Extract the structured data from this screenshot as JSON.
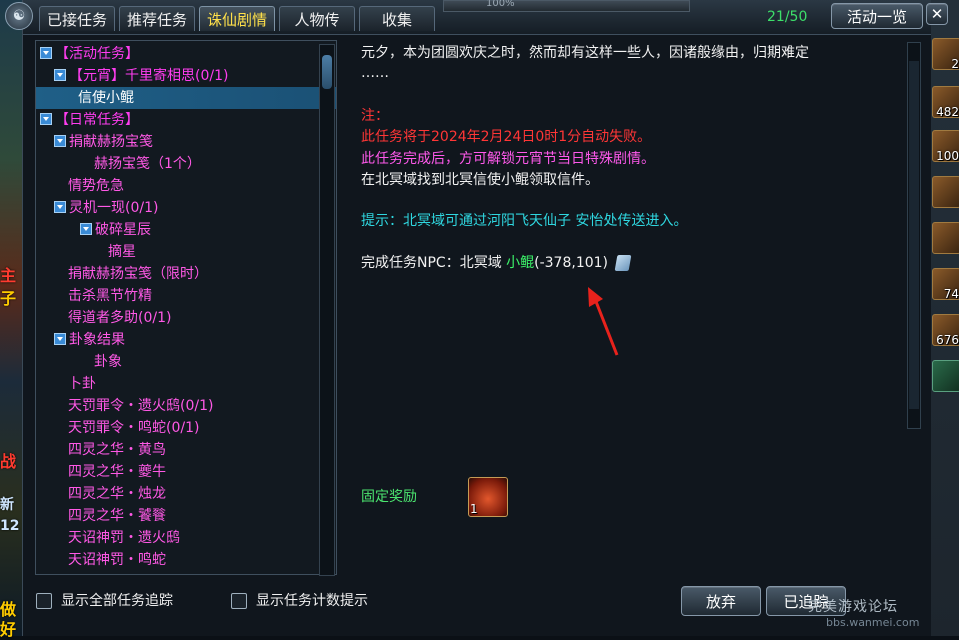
{
  "window": {
    "tabs": [
      {
        "label": "已接任务",
        "active": false
      },
      {
        "label": "推荐任务",
        "active": false
      },
      {
        "label": "诛仙剧情",
        "active": true
      },
      {
        "label": "人物传",
        "active": false
      },
      {
        "label": "收集",
        "active": false
      }
    ],
    "progress_text": "100%",
    "quest_count": "21/50",
    "activity_button": "活动一览",
    "close_icon": "close-icon"
  },
  "tree": {
    "items": [
      {
        "label": "【活动任务】",
        "level": 0,
        "toggle": true,
        "color": "cat"
      },
      {
        "label": "【元宵】千里寄相思(0/1)",
        "level": 1,
        "toggle": true,
        "color": "cat"
      },
      {
        "label": "信使小鲲",
        "level": 2,
        "toggle": false,
        "color": "sel",
        "selected": true
      },
      {
        "label": "【日常任务】",
        "level": 0,
        "toggle": true,
        "color": "cat"
      },
      {
        "label": "捐献赫扬宝笺",
        "level": 1,
        "toggle": true,
        "color": "pink"
      },
      {
        "label": "赫扬宝笺（1个）",
        "level": 2,
        "toggle": false,
        "color": "pink"
      },
      {
        "label": "情势危急",
        "level": 1,
        "toggle": false,
        "color": "pink"
      },
      {
        "label": "灵机一现(0/1)",
        "level": 1,
        "toggle": true,
        "color": "pink"
      },
      {
        "label": "破碎星辰",
        "level": 2,
        "toggle": true,
        "color": "pink"
      },
      {
        "label": "摘星",
        "level": 3,
        "toggle": false,
        "color": "pink"
      },
      {
        "label": "捐献赫扬宝笺（限时）",
        "level": 1,
        "toggle": false,
        "color": "pink"
      },
      {
        "label": "击杀黑节竹精",
        "level": 1,
        "toggle": false,
        "color": "pink"
      },
      {
        "label": "得道者多助(0/1)",
        "level": 1,
        "toggle": false,
        "color": "pink"
      },
      {
        "label": "卦象结果",
        "level": 1,
        "toggle": true,
        "color": "pink"
      },
      {
        "label": "卦象",
        "level": 2,
        "toggle": false,
        "color": "pink"
      },
      {
        "label": "卜卦",
        "level": 1,
        "toggle": false,
        "color": "pink"
      },
      {
        "label": "天罚罪令・遗火鸱(0/1)",
        "level": 1,
        "toggle": false,
        "color": "pink"
      },
      {
        "label": "天罚罪令・鸣蛇(0/1)",
        "level": 1,
        "toggle": false,
        "color": "pink"
      },
      {
        "label": "四灵之华・黄鸟",
        "level": 1,
        "toggle": false,
        "color": "pink"
      },
      {
        "label": "四灵之华・夔牛",
        "level": 1,
        "toggle": false,
        "color": "pink"
      },
      {
        "label": "四灵之华・烛龙",
        "level": 1,
        "toggle": false,
        "color": "pink"
      },
      {
        "label": "四灵之华・饕餮",
        "level": 1,
        "toggle": false,
        "color": "pink"
      },
      {
        "label": "天诏神罚・遗火鸱",
        "level": 1,
        "toggle": false,
        "color": "pink"
      },
      {
        "label": "天诏神罚・鸣蛇",
        "level": 1,
        "toggle": false,
        "color": "pink"
      }
    ]
  },
  "detail": {
    "intro_line1": "元夕，本为团圆欢庆之时，然而却有这样一些人，因诸般缘由，归期难定",
    "intro_line2": "……",
    "note_label": "注：",
    "fail_notice": "此任务将于2024年2月24日0时1分自动失败。",
    "unlock_notice": "此任务完成后，方可解锁元宵节当日特殊剧情。",
    "instruction": "在北冥域找到北冥信使小鲲领取信件。",
    "hint": "提示：北冥域可通过河阳飞天仙子 安怡处传送进入。",
    "npc_prefix": "完成任务NPC：北冥域 ",
    "npc_name": "小鲲",
    "npc_coords": "(-378,101)",
    "reward_label": "固定奖励",
    "reward_count": "1"
  },
  "bottom": {
    "show_all_tracking": "显示全部任务追踪",
    "show_count_hint": "显示任务计数提示",
    "abandon_button": "放弃",
    "tracked_button": "已追踪",
    "watermark": "完美游戏论坛",
    "watermark_url": "bbs.wanmei.com"
  },
  "background": {
    "left_texts": [
      "主",
      "子",
      "做",
      "好",
      "战",
      "新",
      "12"
    ],
    "right_slot_counts": [
      "2",
      "482",
      "100",
      "",
      "",
      "74",
      "676",
      ""
    ]
  },
  "colors": {
    "accent_tab": "#ffe04a",
    "category": "#ff3df0",
    "red_notice": "#ff3636",
    "cyan_hint": "#2fd7e0",
    "green_link": "#3cf66a"
  }
}
